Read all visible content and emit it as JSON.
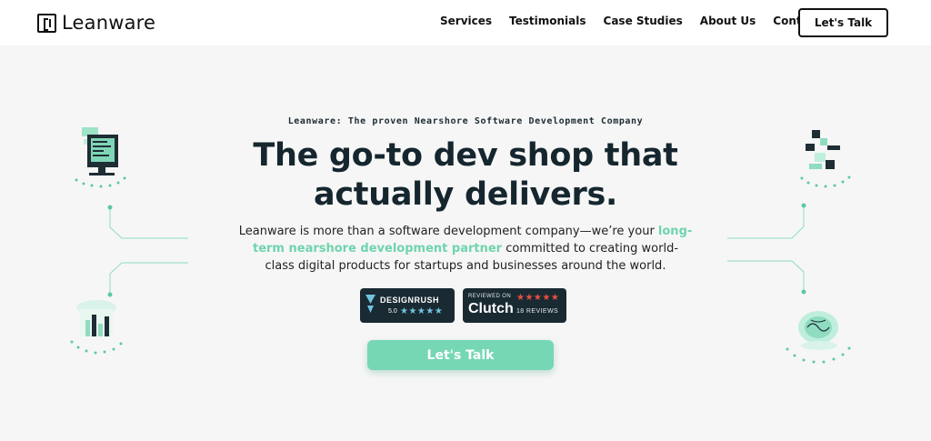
{
  "brand": {
    "name": "Leanware"
  },
  "nav": {
    "links": [
      "Services",
      "Testimonials",
      "Case Studies",
      "About Us",
      "Contact Us"
    ],
    "cta": "Let's Talk"
  },
  "hero": {
    "eyebrow": "Leanware: The proven Nearshore Software Development Company",
    "headline_line1": "The go-to dev shop that",
    "headline_line2": "actually delivers.",
    "sub_before": "Leanware is more than a software development company—we’re your ",
    "sub_highlight": "long-term nearshore development partner",
    "sub_after": " committed to creating world-class digital products for startups and businesses around the world.",
    "cta": "Let's Talk"
  },
  "badges": {
    "designrush": {
      "name": "DESIGNRUSH",
      "score": "5.0",
      "stars": "★★★★★"
    },
    "clutch": {
      "reviewed_on": "REVIEWED ON",
      "name": "Clutch",
      "stars": "★★★★★",
      "reviews": "18 REVIEWS"
    }
  },
  "colors": {
    "accent": "#76d7b4",
    "dark": "#15262e",
    "badge_bg": "#1a2a32",
    "clutch_star": "#e8513e"
  },
  "icons": [
    "code-monitor-icon",
    "puzzle-hand-icon",
    "growth-chart-icon",
    "ai-brain-icon"
  ]
}
